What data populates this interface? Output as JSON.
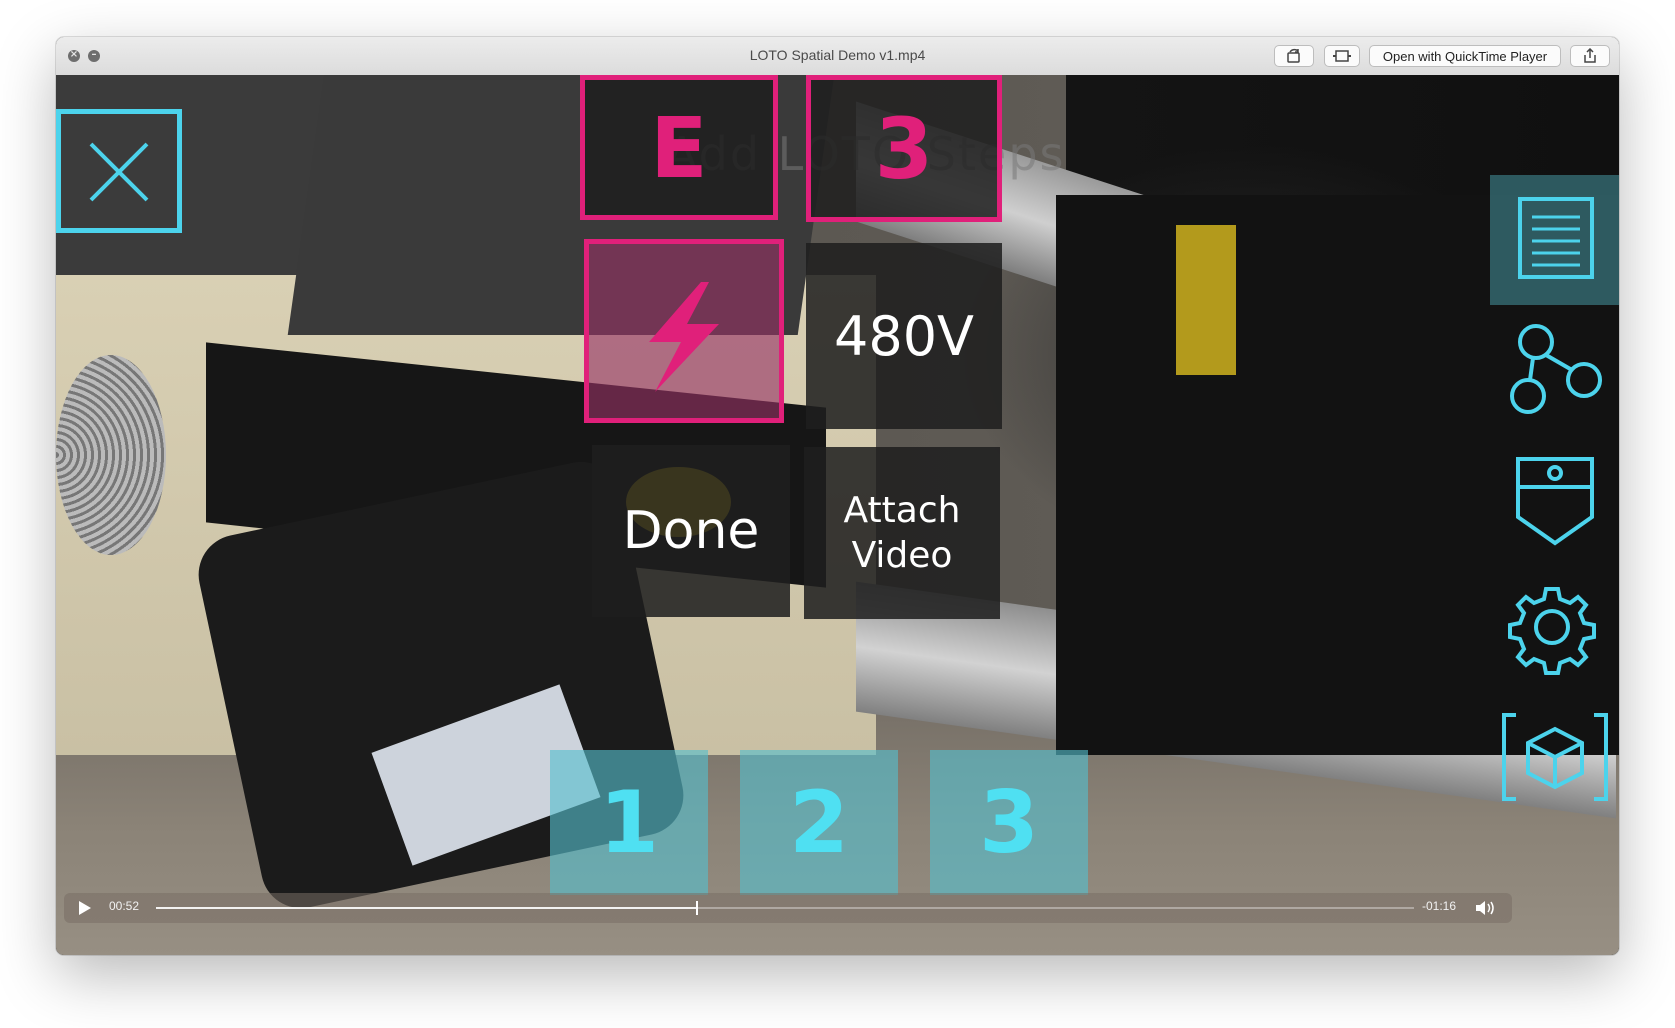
{
  "window": {
    "title": "LOTO Spatial Demo v1.mp4",
    "open_with_label": "Open with QuickTime Player"
  },
  "ar": {
    "ghost_text": "Add LOTO Steps",
    "tile_letter": "E",
    "tile_number": "3",
    "voltage": "480V",
    "done_label": "Done",
    "attach_video_label": "Attach Video",
    "steps": [
      "1",
      "2",
      "3"
    ]
  },
  "player": {
    "elapsed": "00:52",
    "remaining": "-01:16",
    "progress": 0.43
  },
  "colors": {
    "magenta": "#e0207a",
    "cyan": "#4cd3ec",
    "step_tile": "#56becd"
  },
  "icons": {
    "close": "close-icon",
    "document": "document-icon",
    "share_nodes": "share-nodes-icon",
    "pocket": "pocket-icon",
    "settings": "gear-icon",
    "cube": "cube-icon",
    "lightning": "lightning-icon",
    "play": "play-icon",
    "volume": "volume-icon",
    "rotate": "rotate-icon",
    "trim": "trim-icon",
    "share": "share-icon"
  }
}
